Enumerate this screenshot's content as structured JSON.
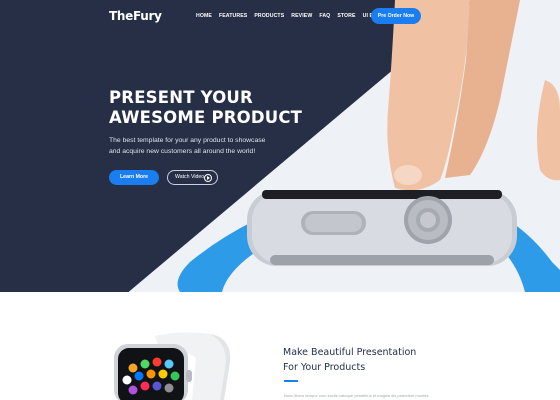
{
  "nav": {
    "logo": "TheFury",
    "items": [
      "HOME",
      "FEATURES",
      "PRODUCTS",
      "REVIEW",
      "FAQ",
      "STORE",
      "UI ELEMENTS"
    ],
    "cta": "Pre Order Now"
  },
  "hero": {
    "headline_line1": "PRESENT YOUR",
    "headline_line2": "AWESOME PRODUCT",
    "subtitle_line1": "The best template for your any product to showcase",
    "subtitle_line2": "and acquire new customers all around the world!",
    "learn_more": "Learn More",
    "watch_video": "Watch Video"
  },
  "features": {
    "title_line1": "Make Beautiful Presentation",
    "title_line2": "For Your Products",
    "body_start": "Nunc libero tempor cum sociis natoque penatibus et magnis dis parturient montes"
  },
  "colors": {
    "navy": "#262f45",
    "accent": "#1a7ef0",
    "band": "#2e9be9"
  }
}
